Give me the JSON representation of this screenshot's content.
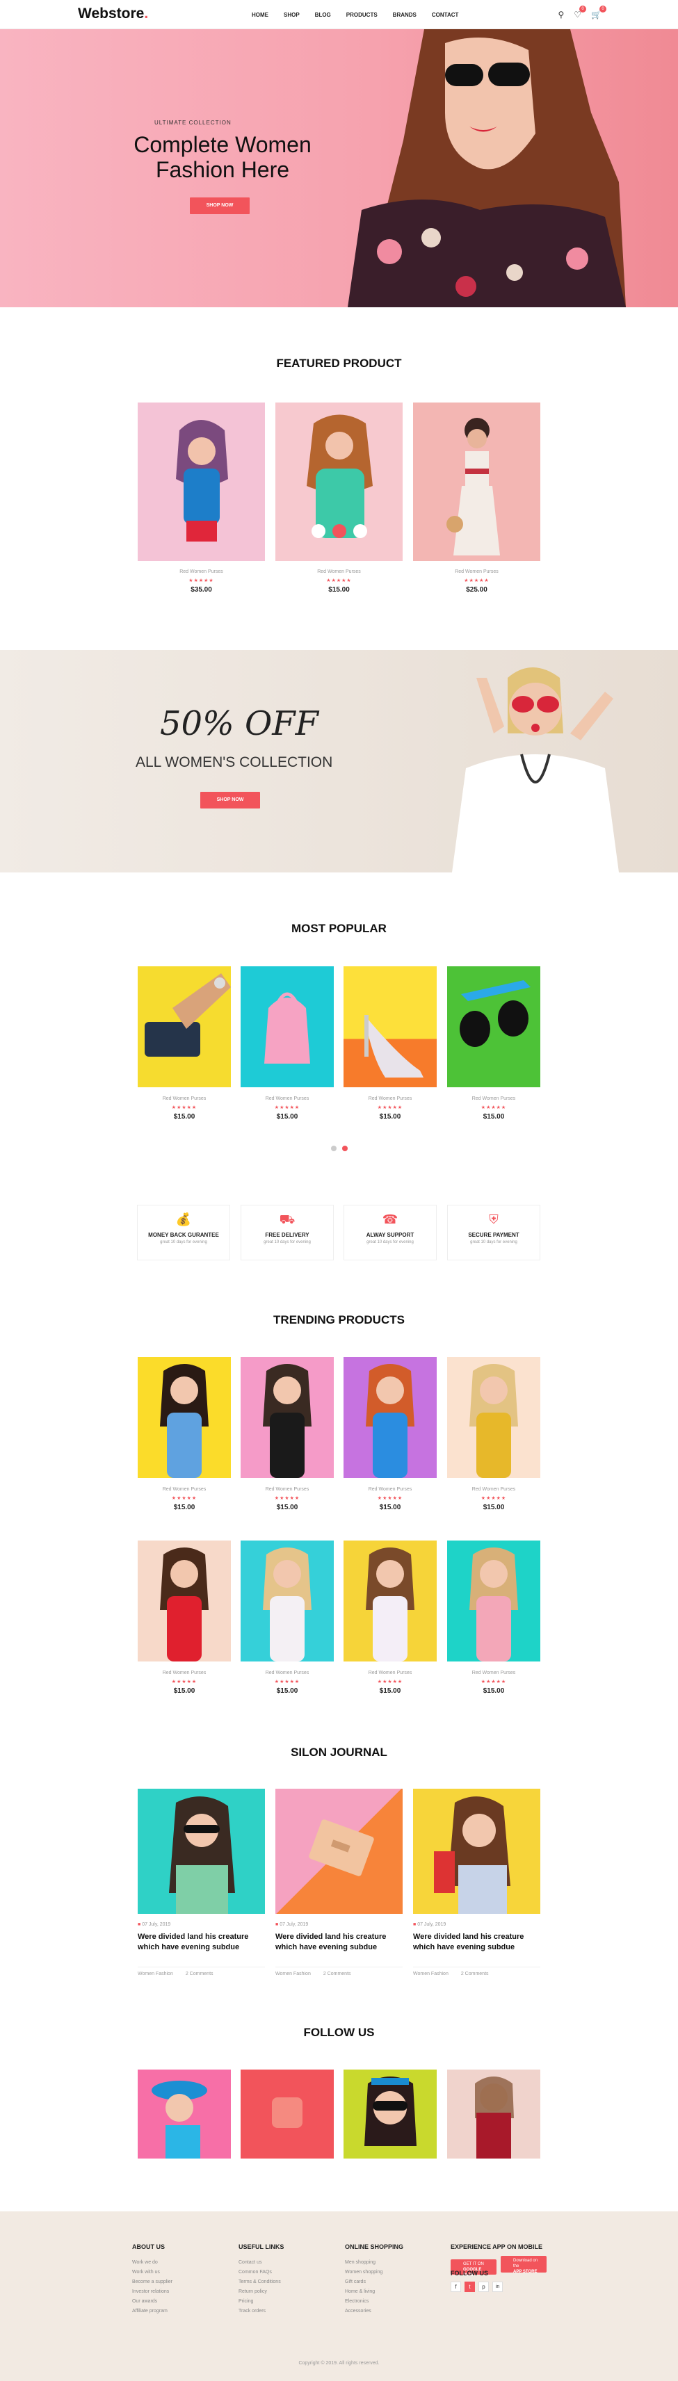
{
  "header": {
    "logo": "Webstore",
    "nav": [
      "HOME",
      "SHOP",
      "BLOG",
      "PRODUCTS",
      "BRANDS",
      "CONTACT"
    ],
    "wishlist_count": "0",
    "cart_count": "0"
  },
  "hero": {
    "subtitle": "ULTIMATE COLLECTION",
    "title": "Complete Women Fashion Here",
    "button": "SHOP NOW"
  },
  "featured": {
    "title": "FEATURED PRODUCT",
    "items": [
      {
        "name": "Red Women Purses",
        "stars": "★★★★★",
        "price": "$35.00"
      },
      {
        "name": "Red Women Purses",
        "stars": "★★★★★",
        "price": "$15.00"
      },
      {
        "name": "Red Women Purses",
        "stars": "★★★★★",
        "price": "$25.00"
      }
    ]
  },
  "banner": {
    "discount": "50% OFF",
    "collection": "ALL WOMEN'S COLLECTION",
    "button": "SHOP NOW"
  },
  "popular": {
    "title": "MOST POPULAR",
    "items": [
      {
        "name": "Red Women Purses",
        "stars": "★★★★★",
        "price": "$15.00"
      },
      {
        "name": "Red Women Purses",
        "stars": "★★★★★",
        "price": "$15.00"
      },
      {
        "name": "Red Women Purses",
        "stars": "★★★★★",
        "price": "$15.00"
      },
      {
        "name": "Red Women Purses",
        "stars": "★★★★★",
        "price": "$15.00"
      }
    ]
  },
  "features": [
    {
      "icon": "money-bag-icon",
      "title": "MONEY BACK GURANTEE",
      "desc": "great 10 days for evening"
    },
    {
      "icon": "truck-icon",
      "title": "FREE DELIVERY",
      "desc": "great 10 days for evening"
    },
    {
      "icon": "headset-icon",
      "title": "ALWAY SUPPORT",
      "desc": "great 10 days for evening"
    },
    {
      "icon": "shield-icon",
      "title": "SECURE PAYMENT",
      "desc": "great 10 days for evening"
    }
  ],
  "trending": {
    "title": "TRENDING PRODUCTS",
    "items": [
      {
        "name": "Red Women Purses",
        "stars": "★★★★★",
        "price": "$15.00"
      },
      {
        "name": "Red Women Purses",
        "stars": "★★★★★",
        "price": "$15.00"
      },
      {
        "name": "Red Women Purses",
        "stars": "★★★★★",
        "price": "$15.00"
      },
      {
        "name": "Red Women Purses",
        "stars": "★★★★★",
        "price": "$15.00"
      },
      {
        "name": "Red Women Purses",
        "stars": "★★★★★",
        "price": "$15.00"
      },
      {
        "name": "Red Women Purses",
        "stars": "★★★★★",
        "price": "$15.00"
      },
      {
        "name": "Red Women Purses",
        "stars": "★★★★★",
        "price": "$15.00"
      },
      {
        "name": "Red Women Purses",
        "stars": "★★★★★",
        "price": "$15.00"
      }
    ]
  },
  "journal": {
    "title": "SILON JOURNAL",
    "posts": [
      {
        "date": "07 July, 2019",
        "title": "Were divided land his creature which have evening subdue",
        "category": "Women Fashion",
        "comments": "2 Comments"
      },
      {
        "date": "07 July, 2019",
        "title": "Were divided land his creature which have evening subdue",
        "category": "Women Fashion",
        "comments": "2 Comments"
      },
      {
        "date": "07 July, 2019",
        "title": "Were divided land his creature which have evening subdue",
        "category": "Women Fashion",
        "comments": "2 Comments"
      }
    ]
  },
  "follow": {
    "title": "FOLLOW US"
  },
  "footer": {
    "columns": [
      {
        "title": "ABOUT US",
        "links": [
          "Work we do",
          "Work with us",
          "Become a supplier",
          "Investor relations",
          "Our awards",
          "Affiliate program"
        ]
      },
      {
        "title": "USEFUL LINKS",
        "links": [
          "Contact us",
          "Common FAQs",
          "Terms & Conditions",
          "Return policy",
          "Pricing",
          "Track orders"
        ]
      },
      {
        "title": "ONLINE SHOPPING",
        "links": [
          "Men shopping",
          "Women shopping",
          "Gift cards",
          "Home & living",
          "Electronics",
          "Accessories"
        ]
      }
    ],
    "app_title": "EXPERIENCE APP ON MOBILE",
    "google": "GOOGLE PLAY",
    "apple": "APP STORE",
    "google_small": "GET IT ON",
    "apple_small": "Download on the",
    "follow_title": "FOLLOW US",
    "socials": [
      "f",
      "t",
      "p",
      "in"
    ],
    "copyright": "Copyright © 2019. All rights reserved."
  },
  "colors": {
    "accent": "#f2545b",
    "hero_bg": "#f6a2ae",
    "banner_bg": "#ede4db",
    "footer_bg": "#f2eae2"
  }
}
